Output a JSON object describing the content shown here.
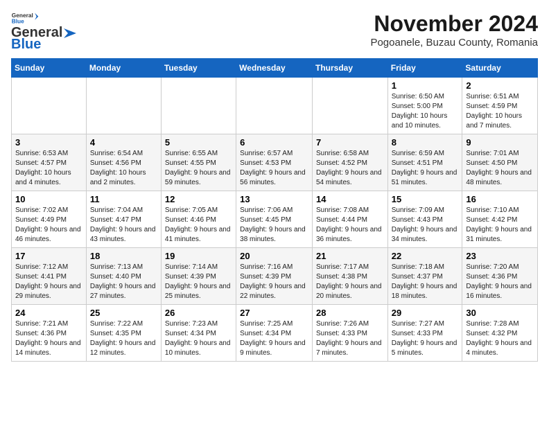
{
  "logo": {
    "general": "General",
    "blue": "Blue"
  },
  "title": {
    "month_year": "November 2024",
    "location": "Pogoanele, Buzau County, Romania"
  },
  "headers": [
    "Sunday",
    "Monday",
    "Tuesday",
    "Wednesday",
    "Thursday",
    "Friday",
    "Saturday"
  ],
  "rows": [
    [
      {
        "day": "",
        "info": ""
      },
      {
        "day": "",
        "info": ""
      },
      {
        "day": "",
        "info": ""
      },
      {
        "day": "",
        "info": ""
      },
      {
        "day": "",
        "info": ""
      },
      {
        "day": "1",
        "info": "Sunrise: 6:50 AM\nSunset: 5:00 PM\nDaylight: 10 hours and 10 minutes."
      },
      {
        "day": "2",
        "info": "Sunrise: 6:51 AM\nSunset: 4:59 PM\nDaylight: 10 hours and 7 minutes."
      }
    ],
    [
      {
        "day": "3",
        "info": "Sunrise: 6:53 AM\nSunset: 4:57 PM\nDaylight: 10 hours and 4 minutes."
      },
      {
        "day": "4",
        "info": "Sunrise: 6:54 AM\nSunset: 4:56 PM\nDaylight: 10 hours and 2 minutes."
      },
      {
        "day": "5",
        "info": "Sunrise: 6:55 AM\nSunset: 4:55 PM\nDaylight: 9 hours and 59 minutes."
      },
      {
        "day": "6",
        "info": "Sunrise: 6:57 AM\nSunset: 4:53 PM\nDaylight: 9 hours and 56 minutes."
      },
      {
        "day": "7",
        "info": "Sunrise: 6:58 AM\nSunset: 4:52 PM\nDaylight: 9 hours and 54 minutes."
      },
      {
        "day": "8",
        "info": "Sunrise: 6:59 AM\nSunset: 4:51 PM\nDaylight: 9 hours and 51 minutes."
      },
      {
        "day": "9",
        "info": "Sunrise: 7:01 AM\nSunset: 4:50 PM\nDaylight: 9 hours and 48 minutes."
      }
    ],
    [
      {
        "day": "10",
        "info": "Sunrise: 7:02 AM\nSunset: 4:49 PM\nDaylight: 9 hours and 46 minutes."
      },
      {
        "day": "11",
        "info": "Sunrise: 7:04 AM\nSunset: 4:47 PM\nDaylight: 9 hours and 43 minutes."
      },
      {
        "day": "12",
        "info": "Sunrise: 7:05 AM\nSunset: 4:46 PM\nDaylight: 9 hours and 41 minutes."
      },
      {
        "day": "13",
        "info": "Sunrise: 7:06 AM\nSunset: 4:45 PM\nDaylight: 9 hours and 38 minutes."
      },
      {
        "day": "14",
        "info": "Sunrise: 7:08 AM\nSunset: 4:44 PM\nDaylight: 9 hours and 36 minutes."
      },
      {
        "day": "15",
        "info": "Sunrise: 7:09 AM\nSunset: 4:43 PM\nDaylight: 9 hours and 34 minutes."
      },
      {
        "day": "16",
        "info": "Sunrise: 7:10 AM\nSunset: 4:42 PM\nDaylight: 9 hours and 31 minutes."
      }
    ],
    [
      {
        "day": "17",
        "info": "Sunrise: 7:12 AM\nSunset: 4:41 PM\nDaylight: 9 hours and 29 minutes."
      },
      {
        "day": "18",
        "info": "Sunrise: 7:13 AM\nSunset: 4:40 PM\nDaylight: 9 hours and 27 minutes."
      },
      {
        "day": "19",
        "info": "Sunrise: 7:14 AM\nSunset: 4:39 PM\nDaylight: 9 hours and 25 minutes."
      },
      {
        "day": "20",
        "info": "Sunrise: 7:16 AM\nSunset: 4:39 PM\nDaylight: 9 hours and 22 minutes."
      },
      {
        "day": "21",
        "info": "Sunrise: 7:17 AM\nSunset: 4:38 PM\nDaylight: 9 hours and 20 minutes."
      },
      {
        "day": "22",
        "info": "Sunrise: 7:18 AM\nSunset: 4:37 PM\nDaylight: 9 hours and 18 minutes."
      },
      {
        "day": "23",
        "info": "Sunrise: 7:20 AM\nSunset: 4:36 PM\nDaylight: 9 hours and 16 minutes."
      }
    ],
    [
      {
        "day": "24",
        "info": "Sunrise: 7:21 AM\nSunset: 4:36 PM\nDaylight: 9 hours and 14 minutes."
      },
      {
        "day": "25",
        "info": "Sunrise: 7:22 AM\nSunset: 4:35 PM\nDaylight: 9 hours and 12 minutes."
      },
      {
        "day": "26",
        "info": "Sunrise: 7:23 AM\nSunset: 4:34 PM\nDaylight: 9 hours and 10 minutes."
      },
      {
        "day": "27",
        "info": "Sunrise: 7:25 AM\nSunset: 4:34 PM\nDaylight: 9 hours and 9 minutes."
      },
      {
        "day": "28",
        "info": "Sunrise: 7:26 AM\nSunset: 4:33 PM\nDaylight: 9 hours and 7 minutes."
      },
      {
        "day": "29",
        "info": "Sunrise: 7:27 AM\nSunset: 4:33 PM\nDaylight: 9 hours and 5 minutes."
      },
      {
        "day": "30",
        "info": "Sunrise: 7:28 AM\nSunset: 4:32 PM\nDaylight: 9 hours and 4 minutes."
      }
    ]
  ]
}
